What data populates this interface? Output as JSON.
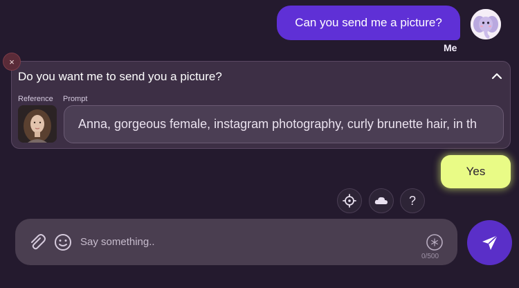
{
  "messages": {
    "user_message": "Can you send me a picture?",
    "sender_label": "Me",
    "reply": "Yes"
  },
  "picture_card": {
    "title": "Do you want me to send you a picture?",
    "reference_label": "Reference",
    "prompt_label": "Prompt",
    "prompt_value": "Anna, gorgeous female, instagram photography, curly brunette hair, in th",
    "close_glyph": "×"
  },
  "tools": {
    "help_glyph": "?"
  },
  "composer": {
    "placeholder": "Say something..",
    "char_counter": "0/500"
  },
  "icons": [
    "avatar-elephant",
    "close-icon",
    "chevron-up-icon",
    "crosshair-icon",
    "cloud-icon",
    "help-icon",
    "paperclip-icon",
    "emoji-icon",
    "sparkle-icon",
    "send-icon"
  ],
  "colors": {
    "background": "#241a2e",
    "user_bubble": "#5f30d6",
    "reply_bubble": "#e9fb86",
    "send_button": "#5a2fc8"
  }
}
